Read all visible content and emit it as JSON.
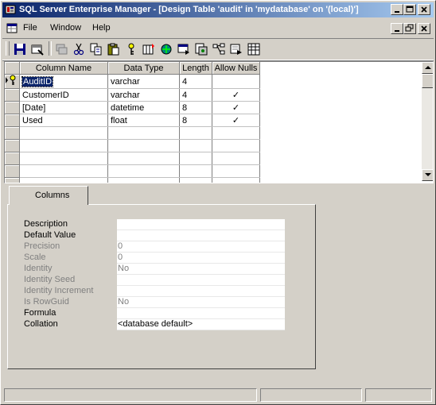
{
  "window": {
    "title": "SQL Server Enterprise Manager - [Design Table 'audit' in 'mydatabase' on '(local)']"
  },
  "menu": {
    "file": "File",
    "window": "Window",
    "help": "Help"
  },
  "toolbar": {
    "icons": [
      "save-icon",
      "table-properties-icon",
      "manage-indexes-icon",
      "cut-icon",
      "copy-icon",
      "paste-icon",
      "set-primary-key-icon",
      "insert-column-icon",
      "manage-relationships-icon",
      "manage-triggers-icon",
      "change-script-icon",
      "manage-constraints-icon",
      "check-constraints-icon",
      "grid-view-icon"
    ]
  },
  "grid": {
    "headers": [
      "Column Name",
      "Data Type",
      "Length",
      "Allow Nulls"
    ],
    "rows": [
      {
        "name": "AuditID",
        "type": "varchar",
        "length": "4",
        "nulls": "",
        "key": true
      },
      {
        "name": "CustomerID",
        "type": "varchar",
        "length": "4",
        "nulls": "✓",
        "key": false
      },
      {
        "name": "[Date]",
        "type": "datetime",
        "length": "8",
        "nulls": "✓",
        "key": false
      },
      {
        "name": "Used",
        "type": "float",
        "length": "8",
        "nulls": "✓",
        "key": false
      }
    ],
    "empty_rows": 5
  },
  "properties": {
    "tab_label": "Columns",
    "rows": [
      {
        "label": "Description",
        "value": "",
        "enabled": true
      },
      {
        "label": "Default Value",
        "value": "",
        "enabled": true
      },
      {
        "label": "Precision",
        "value": "0",
        "enabled": false
      },
      {
        "label": "Scale",
        "value": "0",
        "enabled": false
      },
      {
        "label": "Identity",
        "value": "No",
        "enabled": false
      },
      {
        "label": "Identity Seed",
        "value": "",
        "enabled": false
      },
      {
        "label": "Identity Increment",
        "value": "",
        "enabled": false
      },
      {
        "label": "Is RowGuid",
        "value": "No",
        "enabled": false
      },
      {
        "label": "Formula",
        "value": "",
        "enabled": true
      },
      {
        "label": "Collation",
        "value": "<database default>",
        "enabled": true
      }
    ]
  },
  "colors": {
    "title_start": "#0a246a",
    "title_end": "#a6caf0",
    "face": "#d4d0c8",
    "disabled_text": "#808080"
  }
}
